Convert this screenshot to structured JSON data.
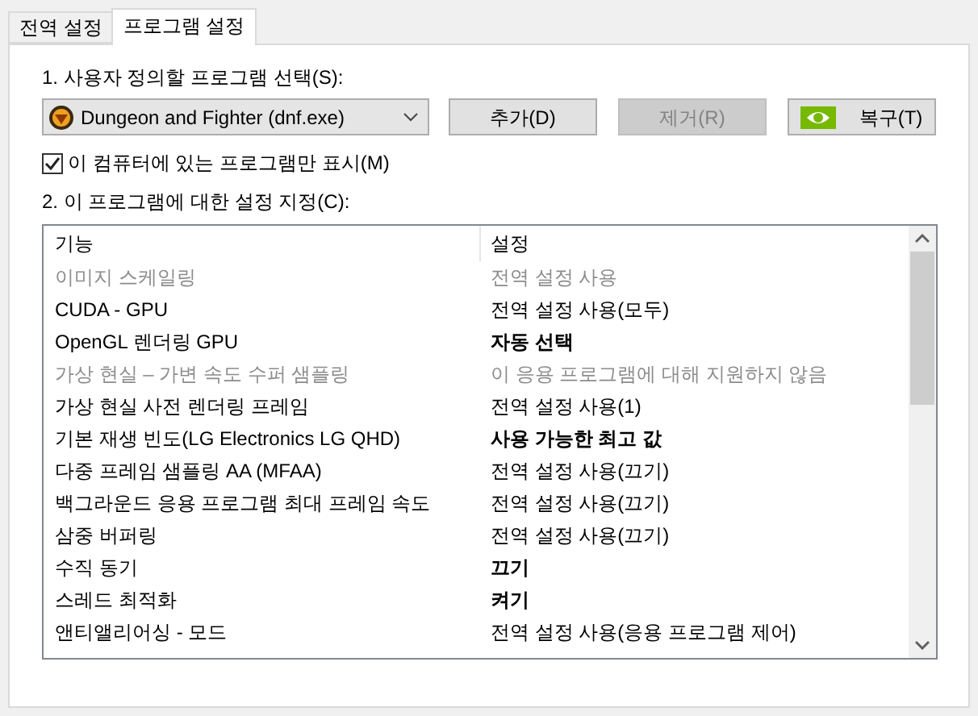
{
  "tabs": [
    {
      "label": "전역 설정",
      "selected": false
    },
    {
      "label": "프로그램 설정",
      "selected": true
    }
  ],
  "step1_label": "1. 사용자 정의할 프로그램 선택(S):",
  "program_dropdown": {
    "value": "Dungeon and Fighter (dnf.exe)"
  },
  "buttons": [
    {
      "label": "추가(D)",
      "disabled": false,
      "kind": "plain"
    },
    {
      "label": "제거(R)",
      "disabled": true,
      "kind": "plain"
    },
    {
      "label": "복구(T)",
      "disabled": false,
      "kind": "logo"
    }
  ],
  "show_only_checkbox": {
    "label": "이 컴퓨터에 있는 프로그램만 표시(M)",
    "checked": true
  },
  "step2_label": "2. 이 프로그램에 대한 설정 지정(C):",
  "table": {
    "columns": [
      "기능",
      "설정"
    ],
    "rows": [
      {
        "feature": "이미지 스케일링",
        "setting": "전역 설정 사용",
        "disabled": true,
        "bold": false
      },
      {
        "feature": "CUDA - GPU",
        "setting": "전역 설정 사용(모두)",
        "disabled": false,
        "bold": false
      },
      {
        "feature": "OpenGL 렌더링 GPU",
        "setting": "자동 선택",
        "disabled": false,
        "bold": true
      },
      {
        "feature": "가상 현실 – 가변 속도 수퍼 샘플링",
        "setting": "이 응용 프로그램에 대해 지원하지 않음",
        "disabled": true,
        "bold": false
      },
      {
        "feature": "가상 현실 사전 렌더링 프레임",
        "setting": "전역 설정 사용(1)",
        "disabled": false,
        "bold": false
      },
      {
        "feature": "기본 재생 빈도(LG Electronics LG QHD)",
        "setting": "사용 가능한 최고 값",
        "disabled": false,
        "bold": true
      },
      {
        "feature": "다중 프레임 샘플링 AA (MFAA)",
        "setting": "전역 설정 사용(끄기)",
        "disabled": false,
        "bold": false
      },
      {
        "feature": "백그라운드 응용 프로그램 최대 프레임 속도",
        "setting": "전역 설정 사용(끄기)",
        "disabled": false,
        "bold": false
      },
      {
        "feature": "삼중 버퍼링",
        "setting": "전역 설정 사용(끄기)",
        "disabled": false,
        "bold": false
      },
      {
        "feature": "수직 동기",
        "setting": "끄기",
        "disabled": false,
        "bold": true
      },
      {
        "feature": "스레드 최적화",
        "setting": "켜기",
        "disabled": false,
        "bold": true
      },
      {
        "feature": "앤티앨리어싱 - 모드",
        "setting": "전역 설정 사용(응용 프로그램 제어)",
        "disabled": false,
        "bold": false
      }
    ]
  }
}
